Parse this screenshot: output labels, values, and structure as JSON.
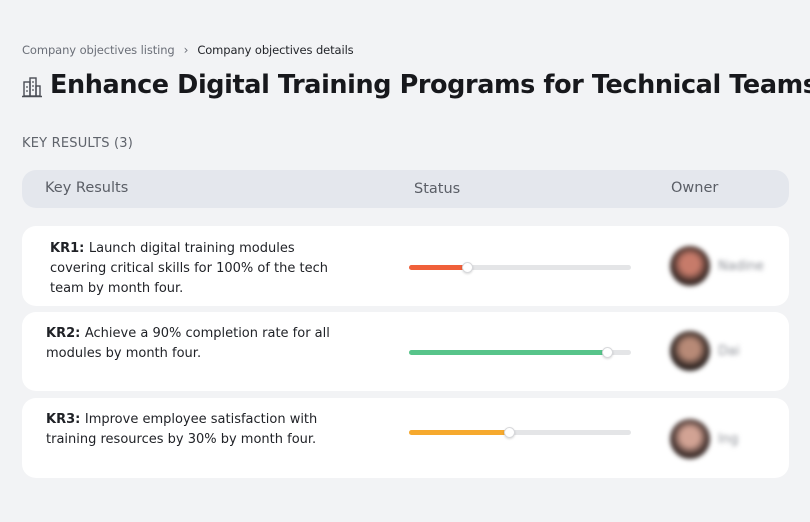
{
  "breadcrumb": {
    "parent": "Company objectives listing",
    "separator": "›",
    "current": "Company objectives details"
  },
  "page": {
    "icon": "building-icon",
    "title": "Enhance Digital Training Programs for Technical Teams"
  },
  "section": {
    "label": "KEY RESULTS (3)"
  },
  "table": {
    "headers": {
      "key_results": "Key Results",
      "status": "Status",
      "owner": "Owner"
    }
  },
  "rows": [
    {
      "id": "KR1:",
      "text": "Launch digital training modules covering critical skills for 100% of the tech team by month four.",
      "progress": 0.26,
      "color": "#f0603a",
      "owner": "Nadine",
      "avatar_colors": [
        "#3a2a26",
        "#c77b6a"
      ]
    },
    {
      "id": "KR2:",
      "text": "Achieve a 90% completion rate for all modules by month four.",
      "progress": 0.89,
      "color": "#57c48a",
      "owner": "Dai",
      "avatar_colors": [
        "#2d2320",
        "#b88a77"
      ]
    },
    {
      "id": "KR3:",
      "text": "Improve employee satisfaction with training resources by 30% by month four.",
      "progress": 0.45,
      "color": "#f6a92e",
      "owner": "Ing",
      "avatar_colors": [
        "#3b2b28",
        "#d2a394"
      ]
    }
  ]
}
